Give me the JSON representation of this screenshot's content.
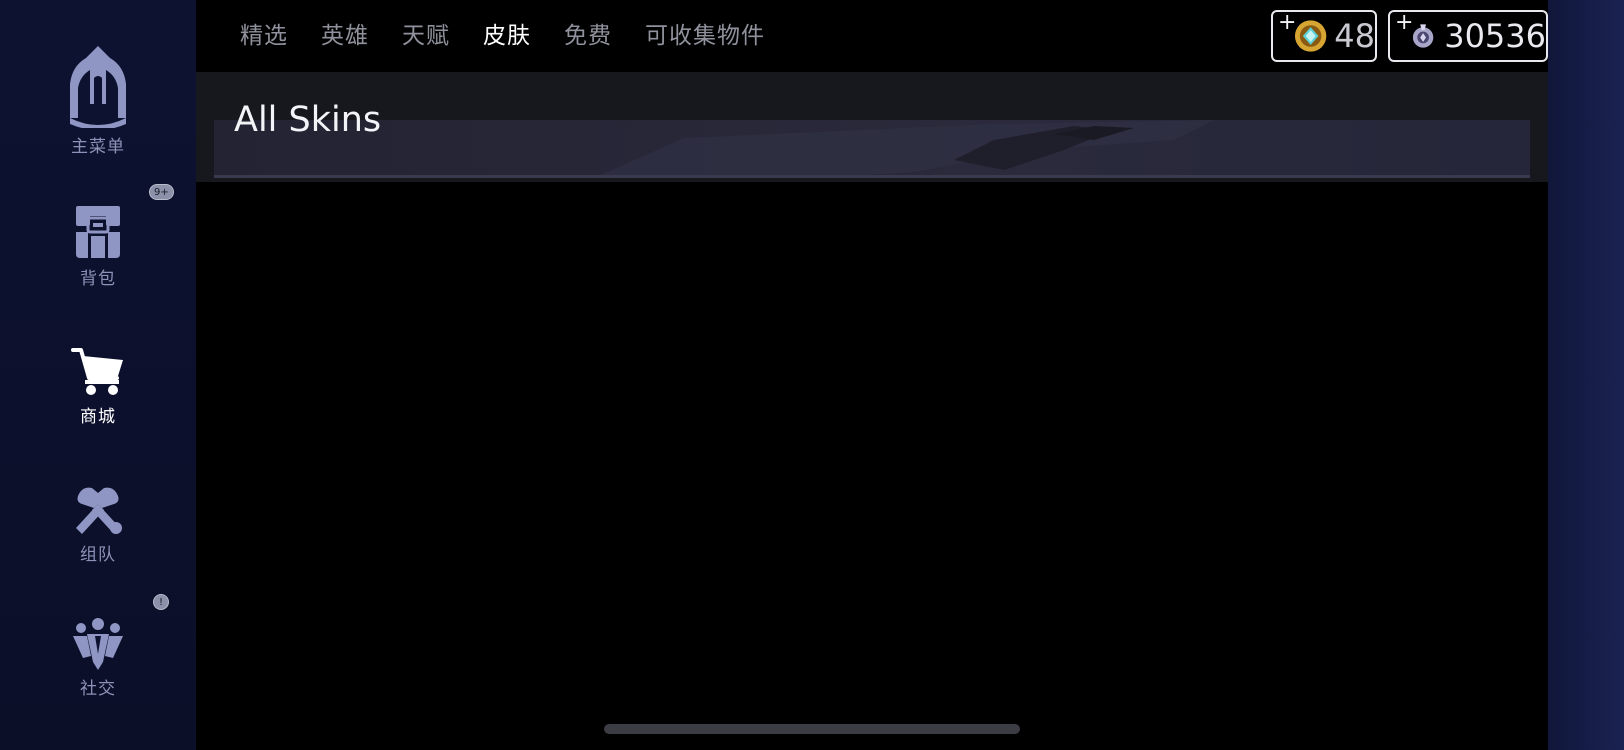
{
  "sidebar": {
    "items": [
      {
        "key": "home",
        "label": "主菜单",
        "icon": "home-tower-icon",
        "active": false
      },
      {
        "key": "backpack",
        "label": "背包",
        "icon": "backpack-icon",
        "active": false,
        "badge": "9+"
      },
      {
        "key": "store",
        "label": "商城",
        "icon": "shopping-cart-icon",
        "active": true
      },
      {
        "key": "team",
        "label": "组队",
        "icon": "team-fist-icon",
        "active": false
      },
      {
        "key": "social",
        "label": "社交",
        "icon": "social-people-icon",
        "active": false,
        "badge": "!"
      }
    ]
  },
  "tabs": [
    {
      "label": "精选",
      "active": false
    },
    {
      "label": "英雄",
      "active": false
    },
    {
      "label": "天赋",
      "active": false
    },
    {
      "label": "皮肤",
      "active": true
    },
    {
      "label": "免费",
      "active": false
    },
    {
      "label": "可收集物件",
      "active": false
    }
  ],
  "currencies": [
    {
      "key": "gold",
      "plus": "+",
      "amount": "48",
      "icon": "gold-coin-icon",
      "color": "#d7a531"
    },
    {
      "key": "silver",
      "plus": "+",
      "amount": "30536",
      "icon": "silver-token-icon",
      "color": "#a8a6c8"
    }
  ],
  "page": {
    "title": "All Skins"
  },
  "colors": {
    "sidebar_label": "#8d93b8",
    "sidebar_icon": "#8f96c4",
    "active": "#ffffff",
    "tab_inactive": "#8f919c"
  }
}
